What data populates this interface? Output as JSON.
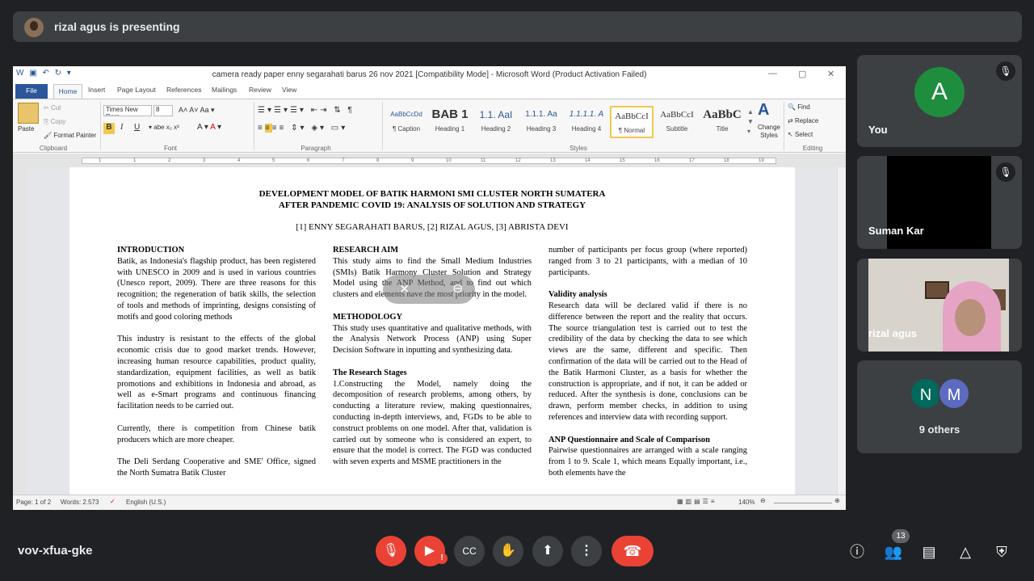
{
  "presentation": {
    "presenter_label": "rizal agus is presenting"
  },
  "word": {
    "window_title": "camera ready paper enny segarahati barus 26 nov 2021 [Compatibility Mode] - Microsoft Word (Product Activation Failed)",
    "tabs": [
      "File",
      "Home",
      "Insert",
      "Page Layout",
      "References",
      "Mailings",
      "Review",
      "View"
    ],
    "clipboard": {
      "paste": "Paste",
      "cut": "Cut",
      "copy": "Copy",
      "format_painter": "Format Painter",
      "label": "Clipboard"
    },
    "font": {
      "name": "Times New Rom",
      "size": "8",
      "label": "Font",
      "bold": "B",
      "italic": "I",
      "underline": "U"
    },
    "paragraph_label": "Paragraph",
    "styles": [
      {
        "preview": "AaBbCcDd",
        "name": "¶ Caption"
      },
      {
        "preview": "BAB 1",
        "name": "Heading 1"
      },
      {
        "preview": "1.1. AaI",
        "name": "Heading 2"
      },
      {
        "preview": "1.1.1. Aa",
        "name": "Heading 3"
      },
      {
        "preview": "1.1.1.1. A",
        "name": "Heading 4"
      },
      {
        "preview": "AaBbCcI",
        "name": "¶ Normal"
      },
      {
        "preview": "AaBbCcI",
        "name": "Subtitle"
      },
      {
        "preview": "AaBbC",
        "name": "Title"
      }
    ],
    "styles_label": "Styles",
    "change_styles": "Change Styles",
    "editing": {
      "find": "Find",
      "replace": "Replace",
      "select": "Select",
      "label": "Editing"
    },
    "ruler_numbers": [
      "1",
      "1",
      "2",
      "3",
      "4",
      "5",
      "6",
      "7",
      "8",
      "9",
      "10",
      "11",
      "12",
      "13",
      "14",
      "15",
      "16",
      "17",
      "18",
      "19"
    ],
    "status": {
      "page": "Page: 1 of 2",
      "words": "Words: 2.573",
      "language": "English (U.S.)",
      "zoom": "140%"
    }
  },
  "document": {
    "title_line1": "DEVELOPMENT MODEL OF BATIK HARMONI SMI CLUSTER NORTH SUMATERA",
    "title_line2": "AFTER PANDEMIC COVID 19: ANALYSIS  OF SOLUTION AND STRATEGY",
    "authors": "[1]  ENNY SEGARAHATI BARUS, [2] RIZAL AGUS, [3] ABRISTA DEVI",
    "col1": {
      "h1": "INTRODUCTION",
      "p1": "Batik, as Indonesia's flagship product, has been registered with UNESCO in 2009 and is used in various countries (Unesco report, 2009). There are three reasons for this recognition; the regeneration of batik skills, the selection of tools and methods of imprinting, designs consisting of motifs and good coloring methods",
      "p2": "This industry is resistant to the effects of the global economic crisis due to good market trends. However, increasing human resource capabilities, product quality, standardization, equipment facilities, as well as batik promotions and exhibitions in Indonesia and abroad, as well as e-Smart programs and continuous financing facilitation needs to be carried out.",
      "p3": "Currently, there is competition from Chinese batik producers which are more cheaper.",
      "p4": "The Deli Serdang Cooperative and SME' Office, signed the North Sumatra Batik Cluster"
    },
    "col2": {
      "h1": "RESEARCH AIM",
      "p1": "This study aims to find the Small Medium Industries (SMIs) Batik Harmony Cluster Solution and Strategy Model using the ANP Method, and to find out which clusters and elements have the most priority in the model.",
      "h2": "METHODOLOGY",
      "p2": "This study uses quantitative and qualitative methods, with the Analysis Network Process (ANP) using Super Decision Software in inputting and synthesizing data.",
      "h3": "The Research Stages",
      "p3": "1.Constructing the Model, namely doing the decomposition of research problems, among others, by conducting a literature review, making questionnaires, conducting in-depth interviews, and, FGDs to be able to construct problems on one model. After that, validation is carried out by someone who is considered an expert, to ensure that the model is correct. The FGD was conducted with seven experts and MSME practitioners in the"
    },
    "col3": {
      "p0": "number of participants per focus group (where reported) ranged from 3 to 21 participants, with a median of 10 participants.",
      "h1": "Validity analysis",
      "p1": "Research data will be declared valid if there is no difference between the report and the reality that occurs. The source triangulation test is carried out to test the credibility of the data by checking the data to see which views are the same, different and specific. Then confirmation of the data will be carried out to the Head of the Batik Harmoni Cluster, as a basis for whether the construction is appropriate, and if not, it can be added or reduced. After the synthesis is done, conclusions can be drawn, perform member checks, in addition to using references and interview data with recording support.",
      "h2": "ANP Questionnaire and Scale of Comparison",
      "p2": "Pairwise questionnaires are arranged with a scale ranging from 1 to 9. Scale 1, which means Equally important, i.e., both elements have the"
    }
  },
  "participants": {
    "you": {
      "initial": "A",
      "name": "You",
      "color": "#1e8e3e"
    },
    "suman": {
      "name": "Suman Kar"
    },
    "rizal": {
      "name": "rizal agus"
    },
    "others": {
      "initial1": "N",
      "initial2": "M",
      "label": "9 others"
    }
  },
  "bottom": {
    "meeting_code": "vov-xfua-gke",
    "people_count": "13"
  },
  "colors": {
    "bg": "#202124",
    "tile": "#3c4043",
    "red": "#ea4335",
    "word_blue": "#2b579a"
  }
}
